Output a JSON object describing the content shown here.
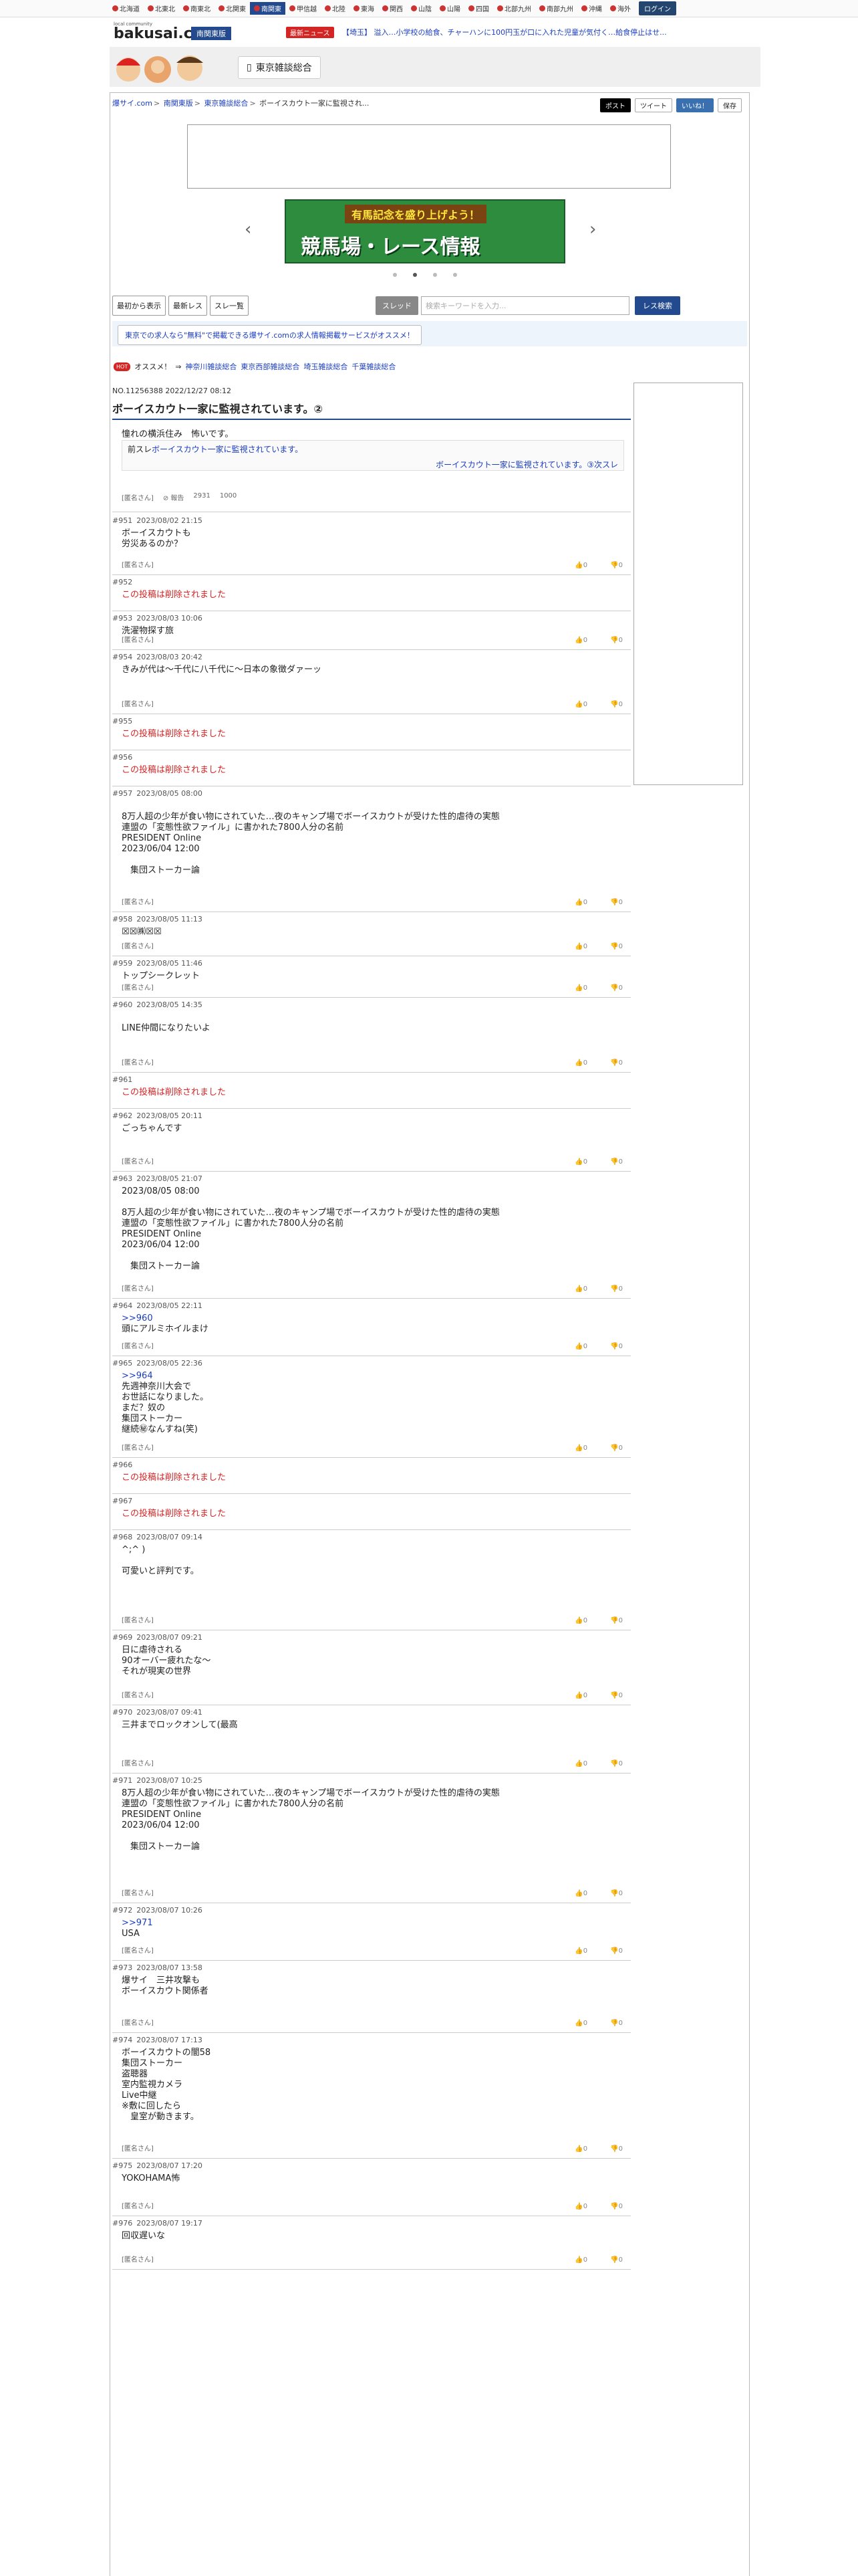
{
  "regions": [
    "北海道",
    "北東北",
    "南東北",
    "北関東",
    "南関東",
    "甲信越",
    "北陸",
    "東海",
    "関西",
    "山陰",
    "山陽",
    "四国",
    "北部九州",
    "南部九州",
    "沖縄",
    "海外"
  ],
  "active_region": "南関東",
  "login_label": "ログイン",
  "logo": {
    "small": "local community",
    "text": "bakusai.com"
  },
  "region_badge": "南関東版",
  "news": {
    "badge": "最新ニュース",
    "text": "【埼玉】 溢入…小学校の給食、チャーハンに100円玉が口に入れた児童が気付く…給食停止はせ..."
  },
  "category_button": "東京雑談総合",
  "breadcrumb": [
    "爆サイ.com",
    "南関東版",
    "東京雑談総合",
    "ボーイスカウト一家に監視され..."
  ],
  "social": {
    "x": "ポスト",
    "tweet": "ツイート",
    "like": "いいね！",
    "save": "保存"
  },
  "carousel": {
    "top": "有馬記念を盛り上げよう！",
    "title": "競馬場・レース情報"
  },
  "toolbar": {
    "from_start": "最初から表示",
    "latest": "最新レス",
    "thread_list": "スレ一覧",
    "scope": "スレッド",
    "search_placeholder": "検索キーワードを入力...",
    "search_btn": "レス検索"
  },
  "info_link": "東京での求人なら\"無料\"で掲載できる爆サイ.comの求人情報掲載サービスがオススメ！",
  "hot": {
    "badge": "HOT",
    "label": "オススメ！",
    "links": [
      "神奈川雑談総合",
      "東京西部雑談総合",
      "埼玉雑談総合",
      "千葉雑談総合"
    ]
  },
  "thread": {
    "meta": "NO.11256388 2022/12/27 08:12",
    "title": "ボーイスカウト一家に監視されています。②",
    "line1": "憧れの横浜住み　怖いです。",
    "quote_prev": "前スレ",
    "quote_prev_link": "ボーイスカウト一家に監視されています。",
    "quote_next": "ボーイスカウト一家に監視されています。③次スレ",
    "author": "[匿名さん]",
    "report": "報告",
    "views": "2931",
    "count": "1000"
  },
  "posts": [
    {
      "no": "#951",
      "date": "2023/08/02 21:15",
      "body": "ボーイスカウトも\n労災あるのか？",
      "deleted": false
    },
    {
      "no": "#952",
      "date": "",
      "body": "この投稿は削除されました",
      "deleted": true
    },
    {
      "no": "#953",
      "date": "2023/08/03 10:06",
      "body": "洗濯物探す旅",
      "deleted": false
    },
    {
      "no": "#954",
      "date": "2023/08/03 20:42",
      "body": "きみが代は〜千代に八千代に〜日本の象徴ダァーッ",
      "deleted": false
    },
    {
      "no": "#955",
      "date": "",
      "body": "この投稿は削除されました",
      "deleted": true
    },
    {
      "no": "#956",
      "date": "",
      "body": "この投稿は削除されました",
      "deleted": true
    },
    {
      "no": "#957",
      "date": "2023/08/05 08:00",
      "body": "\n8万人超の少年が食い物にされていた…夜のキャンプ場でボーイスカウトが受けた性的虐待の実態\n連盟の「変態性欲ファイル」に書かれた7800人分の名前\nPRESIDENT Online\n2023/06/04 12:00\n\n　集団ストーカー論",
      "deleted": false
    },
    {
      "no": "#958",
      "date": "2023/08/05 11:13",
      "body": "☒☒㈱☒☒",
      "deleted": false
    },
    {
      "no": "#959",
      "date": "2023/08/05 11:46",
      "body": "トップシークレット",
      "deleted": false
    },
    {
      "no": "#960",
      "date": "2023/08/05 14:35",
      "body": "\nLINE仲間になりたいよ",
      "deleted": false
    },
    {
      "no": "#961",
      "date": "",
      "body": "この投稿は削除されました",
      "deleted": true
    },
    {
      "no": "#962",
      "date": "2023/08/05 20:11",
      "body": "ごっちゃんです",
      "deleted": false
    },
    {
      "no": "#963",
      "date": "2023/08/05 21:07",
      "body": "2023/08/05 08:00\n\n8万人超の少年が食い物にされていた…夜のキャンプ場でボーイスカウトが受けた性的虐待の実態\n連盟の「変態性欲ファイル」に書かれた7800人分の名前\nPRESIDENT Online\n2023/06/04 12:00\n\n　集団ストーカー論",
      "deleted": false
    },
    {
      "no": "#964",
      "date": "2023/08/05 22:11",
      "anchor": ">>960",
      "body": "頭にアルミホイルまけ",
      "deleted": false
    },
    {
      "no": "#965",
      "date": "2023/08/05 22:36",
      "anchor": ">>964",
      "body": "先週神奈川大会で\nお世話になりました。\nまだ？奴の\n集団ストーカー\n継続㊙なんすね(笑)",
      "deleted": false
    },
    {
      "no": "#966",
      "date": "",
      "body": "この投稿は削除されました",
      "deleted": true
    },
    {
      "no": "#967",
      "date": "",
      "body": "この投稿は削除されました",
      "deleted": true
    },
    {
      "no": "#968",
      "date": "2023/08/07 09:14",
      "body": "^;^ )\n\n可愛いと評判です。",
      "deleted": false
    },
    {
      "no": "#969",
      "date": "2023/08/07 09:21",
      "body": "日に虐待される\n90オーバー疲れたな〜\nそれが現実の世界",
      "deleted": false
    },
    {
      "no": "#970",
      "date": "2023/08/07 09:41",
      "body": "三井までロックオンして(最高",
      "deleted": false
    },
    {
      "no": "#971",
      "date": "2023/08/07 10:25",
      "body": "8万人超の少年が食い物にされていた…夜のキャンプ場でボーイスカウトが受けた性的虐待の実態\n連盟の「変態性欲ファイル」に書かれた7800人分の名前\nPRESIDENT Online\n2023/06/04 12:00\n\n　集団ストーカー論",
      "deleted": false
    },
    {
      "no": "#972",
      "date": "2023/08/07 10:26",
      "anchor": ">>971",
      "body": "USA",
      "deleted": false
    },
    {
      "no": "#973",
      "date": "2023/08/07 13:58",
      "body": "爆サイ　三井攻撃も\nボーイスカウト関係者",
      "deleted": false
    },
    {
      "no": "#974",
      "date": "2023/08/07 17:13",
      "body": "ボーイスカウトの闇58\n集団ストーカー\n盗聴器\n室内監視カメラ\nLive中継\n※敷に回したら\n　皇室が動きます。",
      "deleted": false
    },
    {
      "no": "#975",
      "date": "2023/08/07 17:20",
      "body": "YOKOHAMA怖",
      "deleted": false
    },
    {
      "no": "#976",
      "date": "2023/08/07 19:17",
      "body": "回収遅いな",
      "deleted": false
    }
  ],
  "post_author": "[匿名さん]",
  "vote_up": "0",
  "vote_down": "0"
}
